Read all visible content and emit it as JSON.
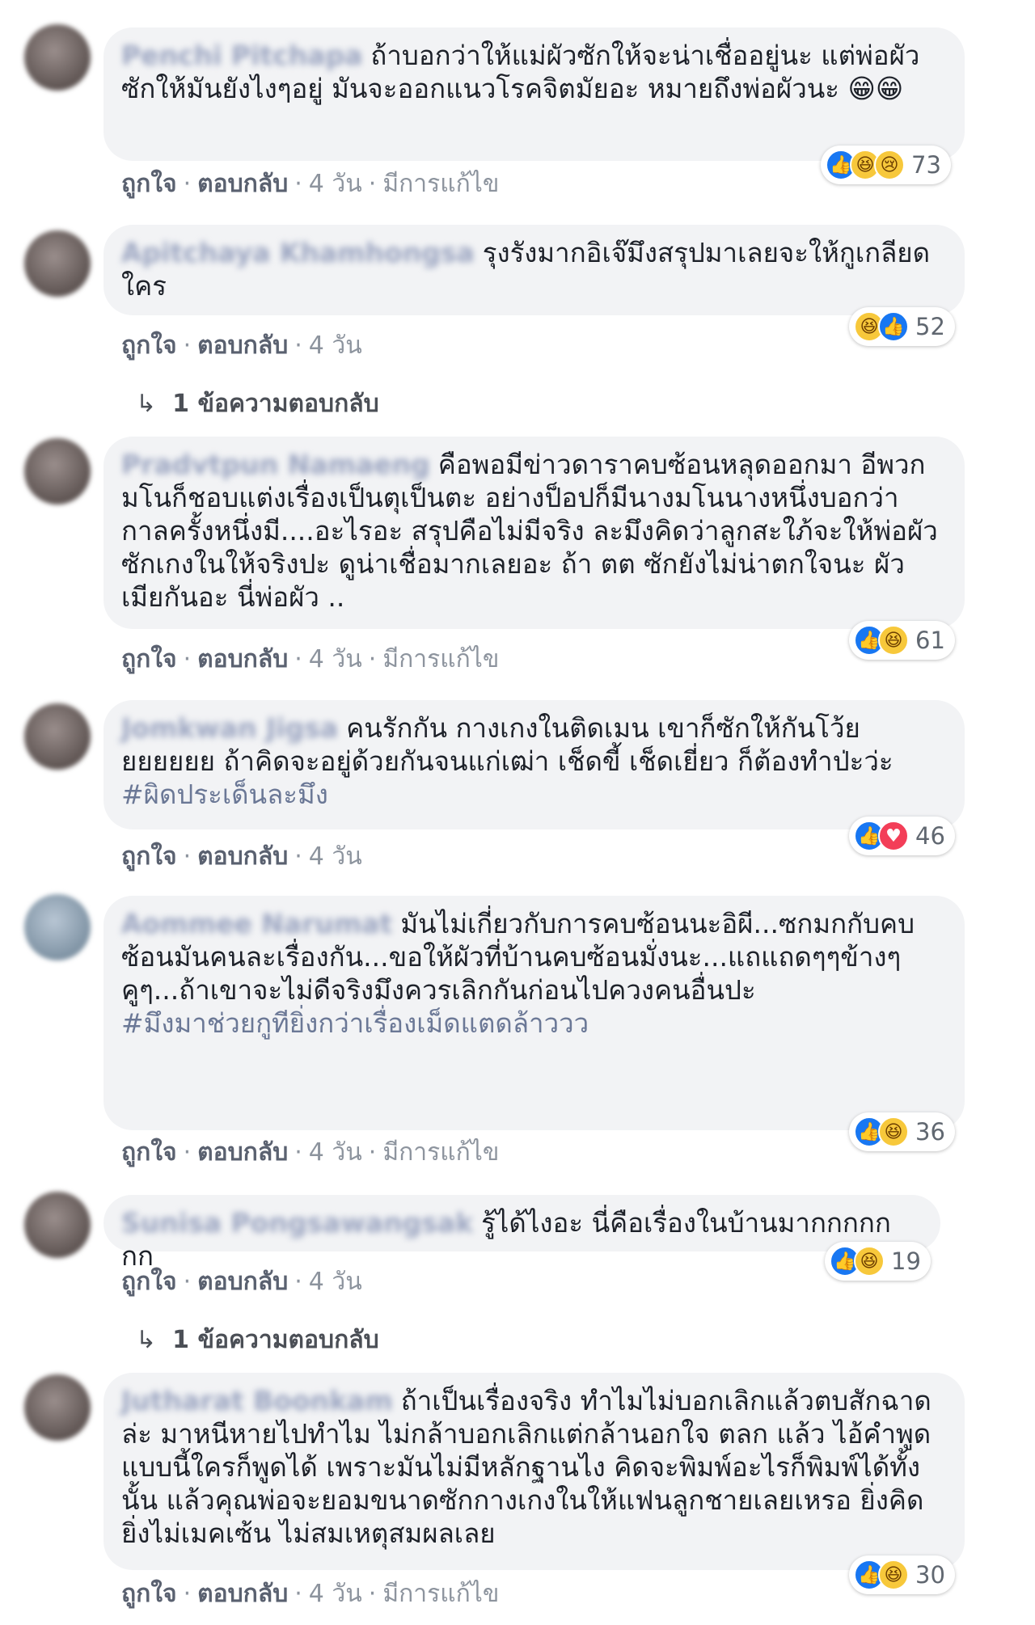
{
  "actions": {
    "like": "ถูกใจ",
    "reply": "ตอบกลับ",
    "time": "4 วัน",
    "edited": "มีการแก้ไข",
    "dot": "·"
  },
  "comments": [
    {
      "name": "Penchi Pitchapa",
      "text": "ถ้าบอกว่าให้แม่ผัวซักให้จะน่าเชื่ออยู่นะ แต่พ่อผัวซักให้มันยังไงๆอยู่ มันจะออกแนวโรคจิตมัยอะ หมายถึงพ่อผัวนะ 😁😁",
      "reactions": [
        "like-icon",
        "haha-icon",
        "sad-icon"
      ],
      "count": "73",
      "edited": true
    },
    {
      "name": "Apitchaya Khamhongsa",
      "text": "รุงรังมากอิเจ๊มึงสรุปมาเลยจะให้กูเกลียดใคร",
      "reactions": [
        "haha-icon",
        "like-icon"
      ],
      "count": "52",
      "edited": false,
      "replies": "1 ข้อความตอบกลับ"
    },
    {
      "name": "Pradvtpun Namaeng",
      "text": "คือพอมีข่าวดาราคบซ้อนหลุดออกมา อีพวกมโนก็ชอบแต่งเรื่องเป็นตุเป็นตะ อย่างป็อปก็มีนางมโนนางหนึ่งบอกว่า กาลครั้งหนึ่งมี....อะไรอะ สรุปคือไม่มีจริง ละมึงคิดว่าลูกสะใภ้จะให้พ่อผัวซักเกงในให้จริงปะ ดูน่าเชื่อมากเลยอะ ถ้า ตต ซักยังไม่น่าตกใจนะ ผัวเมียกันอะ นี่พ่อผัว ..",
      "reactions": [
        "like-icon",
        "haha-icon"
      ],
      "count": "61",
      "edited": true
    },
    {
      "name": "Jomkwan Jigsa",
      "text": "คนรักกัน กางเกงในติดเมน เขาก็ซักให้กันโว้ยยยยยยย ถ้าคิดจะอยู่ด้วยกันจนแก่เฒ่า เช็ดขี้ เช็ดเยี่ยว ก็ต้องทำป่ะว่ะ",
      "hashtag": "#ผิดประเด็นละมึง",
      "reactions": [
        "like-icon",
        "love-icon"
      ],
      "count": "46",
      "edited": false
    },
    {
      "name": "Aommee Narumat",
      "text": "มันไม่เกี่ยวกับการคบซ้อนนะอิผี...ซกมกกับคบซ้อนมันคนละเรื่องกัน...ขอให้ผัวที่บ้านคบซ้อนมั่งนะ...แถแถดๆๆข้างๆคูๆ...ถ้าเขาจะไม่ดีจริงมึงควรเลิกกันก่อนไปควงคนอื่นปะ",
      "hashtag": "#มึงมาช่วยกูทียิ่งกว่าเรื่องเม็ดแตดล้าววว",
      "reactions": [
        "like-icon",
        "haha-icon"
      ],
      "count": "36",
      "edited": true
    },
    {
      "name": "Sunisa Pongsawangsak",
      "text": "รู้ได้ไงอะ นี่คือเรื่องในบ้านมากกกกกกก",
      "reactions": [
        "like-icon",
        "haha-icon"
      ],
      "count": "19",
      "edited": false,
      "replies": "1 ข้อความตอบกลับ"
    },
    {
      "name": "Jutharat Boonkam",
      "text": "ถ้าเป็นเรื่องจริง ทำไมไม่บอกเลิกแล้วตบสักฉาดล่ะ มาหนีหายไปทำไม ไม่กล้าบอกเลิกแต่กล้านอกใจ ตลก แล้ว ไอ้คำพูดแบบนี้ใครก็พูดได้ เพราะมันไม่มีหลักฐานไง คิดจะพิมพ์อะไรก็พิมพ์ได้ทั้งนั้น แล้วคุณพ่อจะยอมขนาดซักกางเกงในให้แฟนลูกชายเลยเหรอ ยิ่งคิดยิ่งไม่เมคเซ้น ไม่สมเหตุสมผลเลย",
      "reactions": [
        "like-icon",
        "haha-icon"
      ],
      "count": "30",
      "edited": true
    }
  ]
}
